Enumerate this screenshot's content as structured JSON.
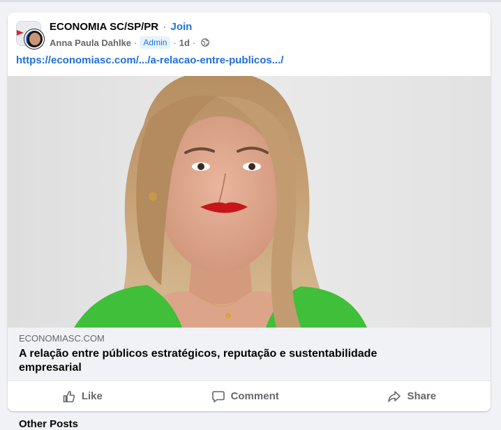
{
  "post": {
    "group_name": "ECONOMIA SC/SP/PR",
    "separator": "·",
    "join_label": "Join",
    "author": "Anna Paula Dahlke",
    "role_badge": "Admin",
    "time_ago": "1d",
    "link_text": "https://economiasc.com/.../a-relacao-entre-publicos.../",
    "preview": {
      "domain": "ECONOMIASC.COM",
      "headline": "A relação entre públicos estratégicos, reputação e sustentabilidade empresarial"
    },
    "actions": {
      "like": "Like",
      "comment": "Comment",
      "share": "Share"
    }
  },
  "footer": {
    "section_title": "Other Posts"
  },
  "colors": {
    "accent": "#1b74e4",
    "link": "#216fdb",
    "muted": "#65676b",
    "preview_bg": "#f0f2f5",
    "jacket_green": "#3fbf3a",
    "lipstick_red": "#c8151c"
  },
  "icons": {
    "globe": "globe-icon",
    "like": "thumbs-up-icon",
    "comment": "speech-bubble-icon",
    "share": "share-arrow-icon"
  }
}
